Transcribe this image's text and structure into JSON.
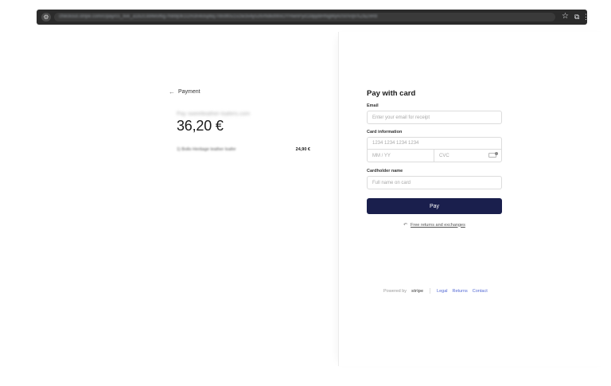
{
  "browser": {
    "url": "checkout.stripe.com/c/pay/cs_live_a1b2c3d4e5f6g7h8i9j0k1l2m3n4o5p6q7r8s9t0u1v2w3x4y5z6#fidkdWxOYHwnPyd1blppbHNgWjA0S0VqVXZ8ZnR8",
    "star_icon": "star-icon",
    "extension_icon": "extension-icon",
    "menu_icon": "menu-icon"
  },
  "summary": {
    "back_label": "Payment",
    "merchant_name": "Pay sweetleather-loafers.com",
    "total": "36,20 €",
    "line_items": [
      {
        "name": "1) Bollo Heritage leather loafer",
        "price": "24,90 €"
      }
    ]
  },
  "form": {
    "title": "Pay with card",
    "email_label": "Email",
    "email_placeholder": "Enter your email for receipt",
    "card_label": "Card information",
    "card_number_placeholder": "1234 1234 1234 1234",
    "expiry_placeholder": "MM / YY",
    "cvc_placeholder": "CVC",
    "name_label": "Cardholder name",
    "name_placeholder": "Full name on card",
    "pay_label": "Pay",
    "returns_text": "Free returns and exchanges"
  },
  "footer": {
    "powered_by": "Powered by",
    "brand": "stripe",
    "links": [
      "Legal",
      "Returns",
      "Contact"
    ]
  },
  "colors": {
    "pay_button": "#1a1f4d",
    "link": "#5469d4",
    "browser_bar": "#2b2b2b"
  }
}
